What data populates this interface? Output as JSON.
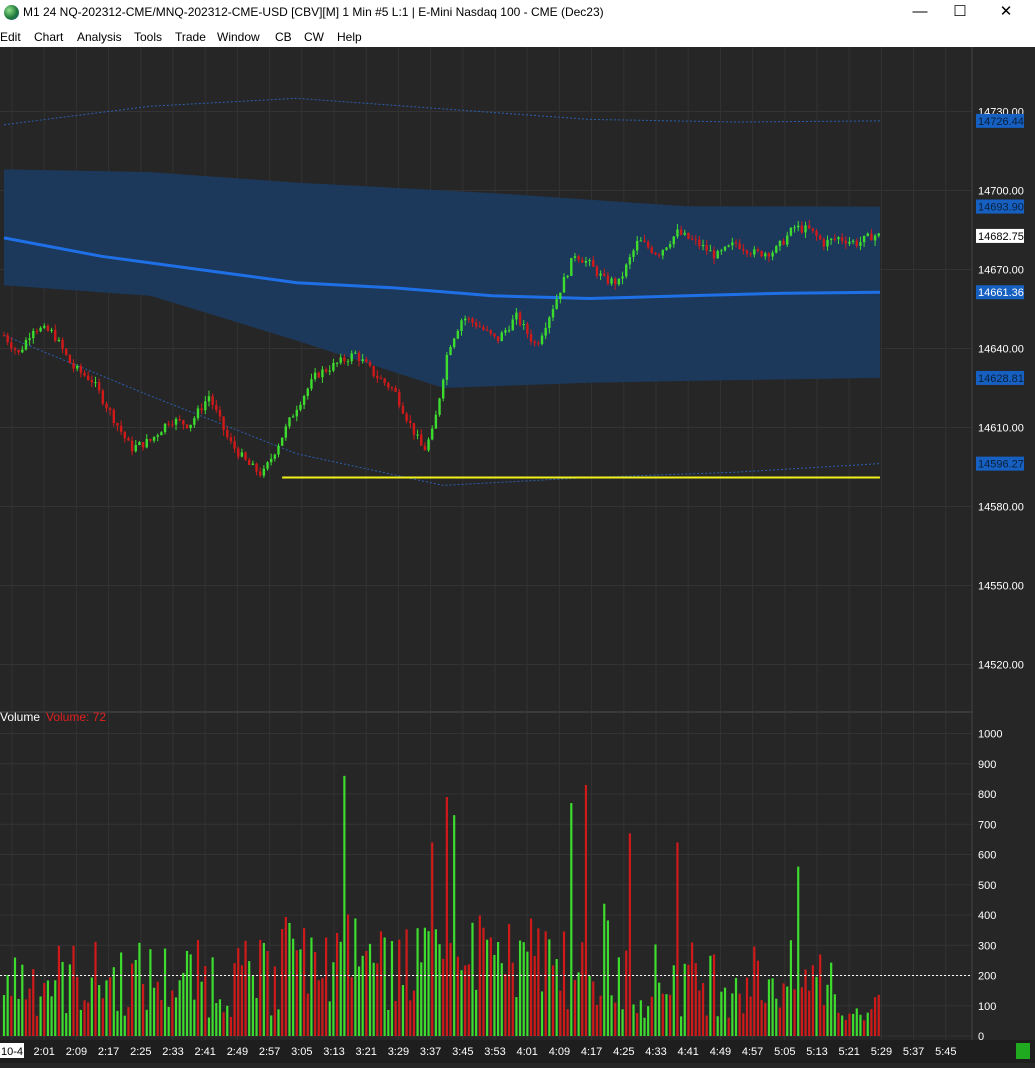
{
  "window": {
    "title": "M1 24 NQ-202312-CME/MNQ-202312-CME-USD [CBV][M]  1 Min  #5 L:1 | E-Mini Nasdaq 100 - CME (Dec23)",
    "minimize_symbol": "—",
    "maximize_symbol": "☐",
    "close_symbol": "✕"
  },
  "menu": [
    "Edit",
    "Chart",
    "Analysis",
    "Tools",
    "Trade",
    "Window",
    "CB",
    "CW",
    "Help"
  ],
  "colors": {
    "background": "#262626",
    "grid": "#333333",
    "up": "#3ddc2f",
    "down": "#d01a1a",
    "vwap": "#1f6fe6",
    "band": "#1b3a5f",
    "band_lines": "#2a5fb0",
    "support": "#f2f21a",
    "axis_text": "#ffffff",
    "badge": "#1560c0"
  },
  "chart_data": [
    {
      "type": "candlestick",
      "title": "",
      "y_ticks": [
        "14730.00",
        "14700.00",
        "14670.00",
        "14640.00",
        "14610.00",
        "14580.00",
        "14550.00",
        "14520.00"
      ],
      "ylim": [
        14490,
        14755
      ],
      "x_ticks": [
        "10-4",
        "2:01",
        "2:09",
        "2:17",
        "2:25",
        "2:33",
        "2:41",
        "2:49",
        "2:57",
        "3:05",
        "3:13",
        "3:21",
        "3:29",
        "3:37",
        "3:45",
        "3:53",
        "4:01",
        "4:09",
        "4:17",
        "4:25",
        "4:33",
        "4:41",
        "4:49",
        "4:57",
        "5:05",
        "5:13",
        "5:21",
        "5:29",
        "5:37",
        "5:45"
      ],
      "last_price": "14682.75",
      "band_levels": {
        "upper_outer": "14726.44",
        "upper_inner": "14693.90",
        "vwap": "14661.36",
        "lower_inner": "14628.81",
        "lower_outer": "14596.27"
      },
      "support_level": 14591,
      "close_path": [
        [
          0,
          14645
        ],
        [
          6,
          14638
        ],
        [
          12,
          14648
        ],
        [
          20,
          14646
        ],
        [
          28,
          14633
        ],
        [
          36,
          14628
        ],
        [
          44,
          14615
        ],
        [
          52,
          14602
        ],
        [
          60,
          14605
        ],
        [
          68,
          14613
        ],
        [
          76,
          14611
        ],
        [
          84,
          14622
        ],
        [
          92,
          14605
        ],
        [
          100,
          14596
        ],
        [
          106,
          14592
        ],
        [
          112,
          14603
        ],
        [
          120,
          14618
        ],
        [
          128,
          14630
        ],
        [
          136,
          14634
        ],
        [
          144,
          14638
        ],
        [
          152,
          14630
        ],
        [
          160,
          14624
        ],
        [
          166,
          14612
        ],
        [
          172,
          14601
        ],
        [
          176,
          14609
        ],
        [
          182,
          14640
        ],
        [
          188,
          14652
        ],
        [
          194,
          14649
        ],
        [
          202,
          14643
        ],
        [
          210,
          14652
        ],
        [
          218,
          14641
        ],
        [
          226,
          14658
        ],
        [
          234,
          14676
        ],
        [
          240,
          14672
        ],
        [
          246,
          14666
        ],
        [
          252,
          14665
        ],
        [
          260,
          14681
        ],
        [
          268,
          14676
        ],
        [
          276,
          14684
        ],
        [
          284,
          14680
        ],
        [
          292,
          14675
        ],
        [
          300,
          14680
        ],
        [
          308,
          14676
        ],
        [
          316,
          14677
        ],
        [
          324,
          14686
        ],
        [
          330,
          14685
        ],
        [
          336,
          14680
        ],
        [
          342,
          14682
        ],
        [
          350,
          14680
        ],
        [
          356,
          14683
        ],
        [
          359,
          14682.75
        ]
      ],
      "vwap_path": [
        [
          0,
          14682
        ],
        [
          40,
          14675
        ],
        [
          80,
          14670
        ],
        [
          120,
          14665
        ],
        [
          160,
          14663
        ],
        [
          200,
          14660
        ],
        [
          240,
          14659
        ],
        [
          280,
          14660
        ],
        [
          320,
          14661
        ],
        [
          359,
          14661.36
        ]
      ],
      "band_upper_path": [
        [
          0,
          14708
        ],
        [
          60,
          14707
        ],
        [
          120,
          14703
        ],
        [
          200,
          14699
        ],
        [
          280,
          14694
        ],
        [
          359,
          14693.9
        ]
      ],
      "band_lower_path": [
        [
          0,
          14664
        ],
        [
          60,
          14660
        ],
        [
          120,
          14643
        ],
        [
          180,
          14625
        ],
        [
          240,
          14627
        ],
        [
          300,
          14628
        ],
        [
          359,
          14628.81
        ]
      ],
      "outer_upper_path": [
        [
          0,
          14725
        ],
        [
          60,
          14732
        ],
        [
          120,
          14735
        ],
        [
          180,
          14731
        ],
        [
          240,
          14727
        ],
        [
          300,
          14726
        ],
        [
          359,
          14726.44
        ]
      ],
      "outer_lower_path": [
        [
          0,
          14645
        ],
        [
          60,
          14622
        ],
        [
          120,
          14600
        ],
        [
          180,
          14588
        ],
        [
          240,
          14591
        ],
        [
          300,
          14593
        ],
        [
          359,
          14596.27
        ]
      ]
    },
    {
      "type": "bar",
      "title": "Volume",
      "legend": "Volume: 72",
      "y_ticks": [
        "1000",
        "900",
        "800",
        "700",
        "600",
        "500",
        "400",
        "300",
        "200",
        "100",
        "0"
      ],
      "ylim": [
        0,
        1000
      ],
      "reference_line": 200,
      "spikes": [
        {
          "t": 140,
          "v": 860
        },
        {
          "t": 176,
          "v": 640
        },
        {
          "t": 182,
          "v": 790
        },
        {
          "t": 184,
          "v": 730
        },
        {
          "t": 232,
          "v": 770
        },
        {
          "t": 238,
          "v": 830
        },
        {
          "t": 256,
          "v": 670
        },
        {
          "t": 276,
          "v": 640
        },
        {
          "t": 326,
          "v": 560
        }
      ]
    }
  ]
}
